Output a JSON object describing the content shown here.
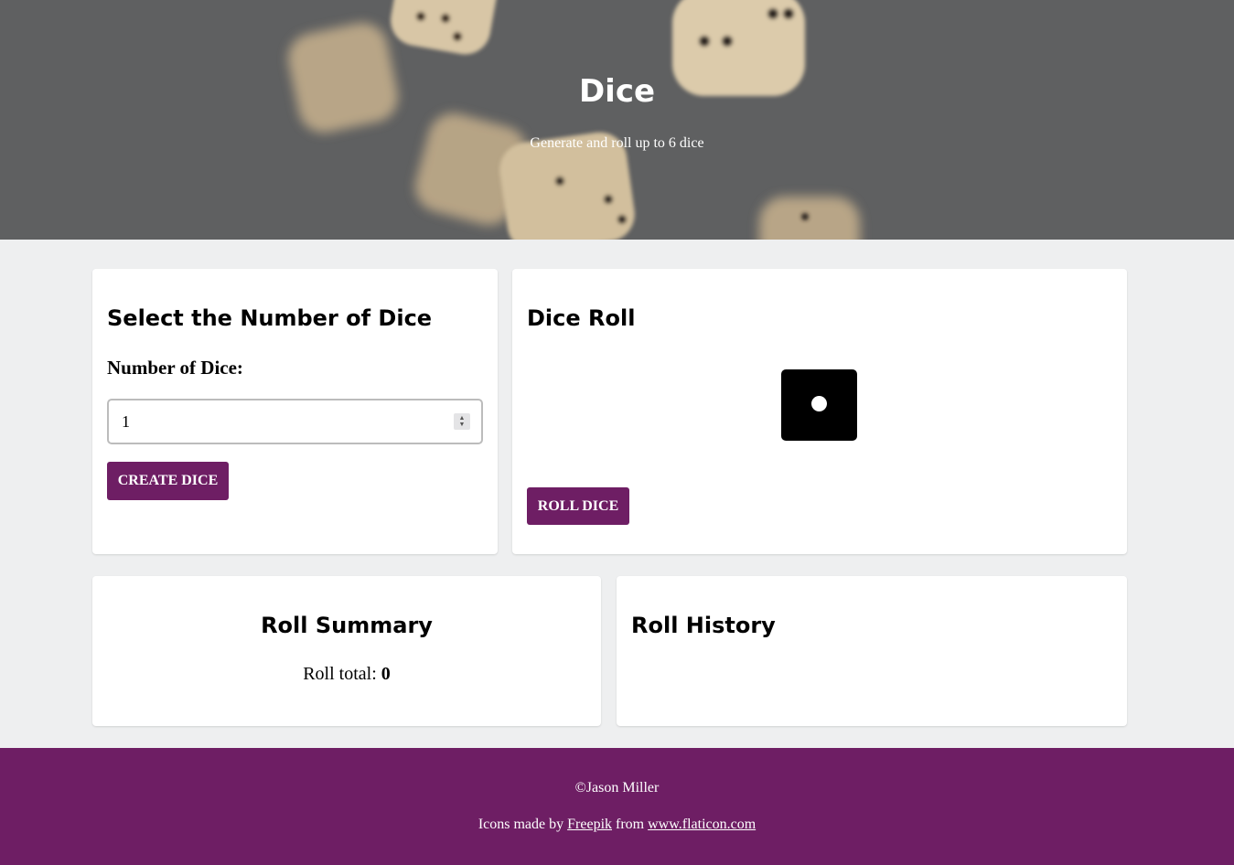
{
  "header": {
    "title": "Dice",
    "subtitle": "Generate and roll up to 6 dice"
  },
  "select_card": {
    "title": "Select the Number of Dice",
    "label": "Number of Dice:",
    "input_value": "1",
    "button_label": "CREATE DICE"
  },
  "roll_card": {
    "title": "Dice Roll",
    "dice_values": [
      1
    ],
    "button_label": "ROLL DICE"
  },
  "summary_card": {
    "title": "Roll Summary",
    "total_label": "Roll total: ",
    "total_value": "0"
  },
  "history_card": {
    "title": "Roll History"
  },
  "footer": {
    "copyright": "©Jason Miller",
    "credit_prefix": "Icons made by ",
    "credit_author": "Freepik",
    "credit_middle": " from ",
    "credit_site": "www.flaticon.com"
  },
  "colors": {
    "accent": "#6e1e64",
    "page_bg": "#eeeff0",
    "die": "#000000"
  }
}
